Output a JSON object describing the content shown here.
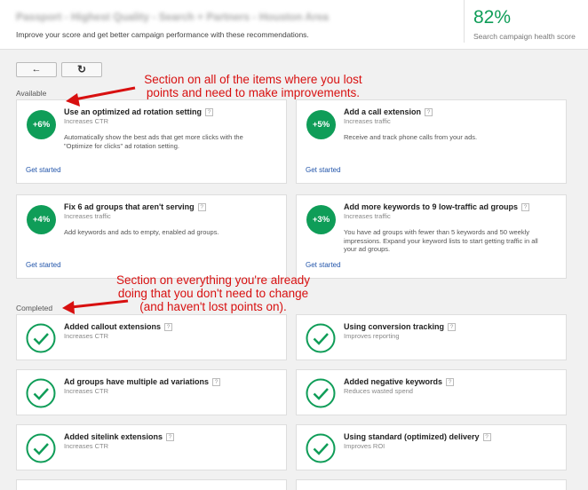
{
  "header": {
    "campaign_title": "Passport - Highest Quality - Search + Partners - Houston Area",
    "subtitle": "Improve your score and get better campaign performance with these recommendations.",
    "score": "82%",
    "score_label": "Search campaign health score"
  },
  "toolbar": {
    "back_icon": "←",
    "refresh_icon": "↻"
  },
  "colors": {
    "accent": "#0f9d58",
    "annotation": "#d81010",
    "link": "#2255aa"
  },
  "available": {
    "label": "Available",
    "cards": [
      {
        "badge": "+6%",
        "title": "Use an optimized ad rotation setting",
        "help": "?",
        "subtitle": "Increases CTR",
        "description": "Automatically show the best ads that get more clicks with the \"Optimize for clicks\" ad rotation setting.",
        "link": "Get started"
      },
      {
        "badge": "+5%",
        "title": "Add a call extension",
        "help": "?",
        "subtitle": "Increases traffic",
        "description": "Receive and track phone calls from your ads.",
        "link": "Get started"
      },
      {
        "badge": "+4%",
        "title": "Fix 6 ad groups that aren't serving",
        "help": "?",
        "subtitle": "Increases traffic",
        "description": "Add keywords and ads to empty, enabled ad groups.",
        "link": "Get started"
      },
      {
        "badge": "+3%",
        "title": "Add more keywords to 9 low-traffic ad groups",
        "help": "?",
        "subtitle": "Increases traffic",
        "description": "You have ad groups with fewer than 5 keywords and 50 weekly impressions. Expand your keyword lists to start getting traffic in all your ad groups.",
        "link": "Get started"
      }
    ]
  },
  "completed": {
    "label": "Completed",
    "cards": [
      {
        "title": "Added callout extensions",
        "help": "?",
        "subtitle": "Increases CTR"
      },
      {
        "title": "Using conversion tracking",
        "help": "?",
        "subtitle": "Improves reporting"
      },
      {
        "title": "Ad groups have multiple ad variations",
        "help": "?",
        "subtitle": "Increases CTR"
      },
      {
        "title": "Added negative keywords",
        "help": "?",
        "subtitle": "Reduces wasted spend"
      },
      {
        "title": "Added sitelink extensions",
        "help": "?",
        "subtitle": "Increases CTR"
      },
      {
        "title": "Using standard (optimized) delivery",
        "help": "?",
        "subtitle": "Improves ROI"
      }
    ]
  },
  "annotations": {
    "first": [
      "Section on all of the items where you lost",
      "points and need to make improvements."
    ],
    "second": [
      "Section on everything you're already",
      "doing that you don't need to change",
      "(and haven't lost points on)."
    ]
  }
}
